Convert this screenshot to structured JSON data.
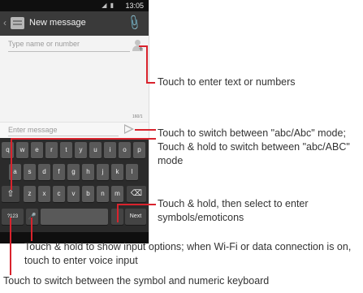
{
  "status_bar": {
    "icons": "◢ ▮",
    "time": "13:05"
  },
  "action_bar": {
    "title": "New message"
  },
  "recipient": {
    "placeholder": "Type name or number"
  },
  "compose": {
    "counter": "160/1",
    "placeholder": "Enter message"
  },
  "keyboard": {
    "row1": [
      "q",
      "w",
      "e",
      "r",
      "t",
      "y",
      "u",
      "i",
      "o",
      "p"
    ],
    "row2": [
      "a",
      "s",
      "d",
      "f",
      "g",
      "h",
      "j",
      "k",
      "l"
    ],
    "row3": [
      "⇧",
      "z",
      "x",
      "c",
      "v",
      "b",
      "n",
      "m",
      "⌫"
    ],
    "row4": {
      "symbols": "?123",
      "mic": "🎤",
      "space": "",
      "period": ".",
      "next": "Next"
    }
  },
  "callouts": [
    {
      "text": "Touch to enter text or numbers"
    },
    {
      "text": "Touch to switch  between \"abc/Abc\" mode; Touch & hold to switch between \"abc/ABC\" mode"
    },
    {
      "text": "Touch & hold, then select to enter symbols/emoticons"
    },
    {
      "text": "Touch & hold to show input options; when Wi-Fi or data connection is on, touch to enter voice input"
    },
    {
      "text": "Touch to switch between the symbol and numeric keyboard"
    }
  ],
  "colors": {
    "callout_line": "#d9232d",
    "action_bar": "#3a3a3a",
    "keyboard": "#2b2b2b"
  }
}
